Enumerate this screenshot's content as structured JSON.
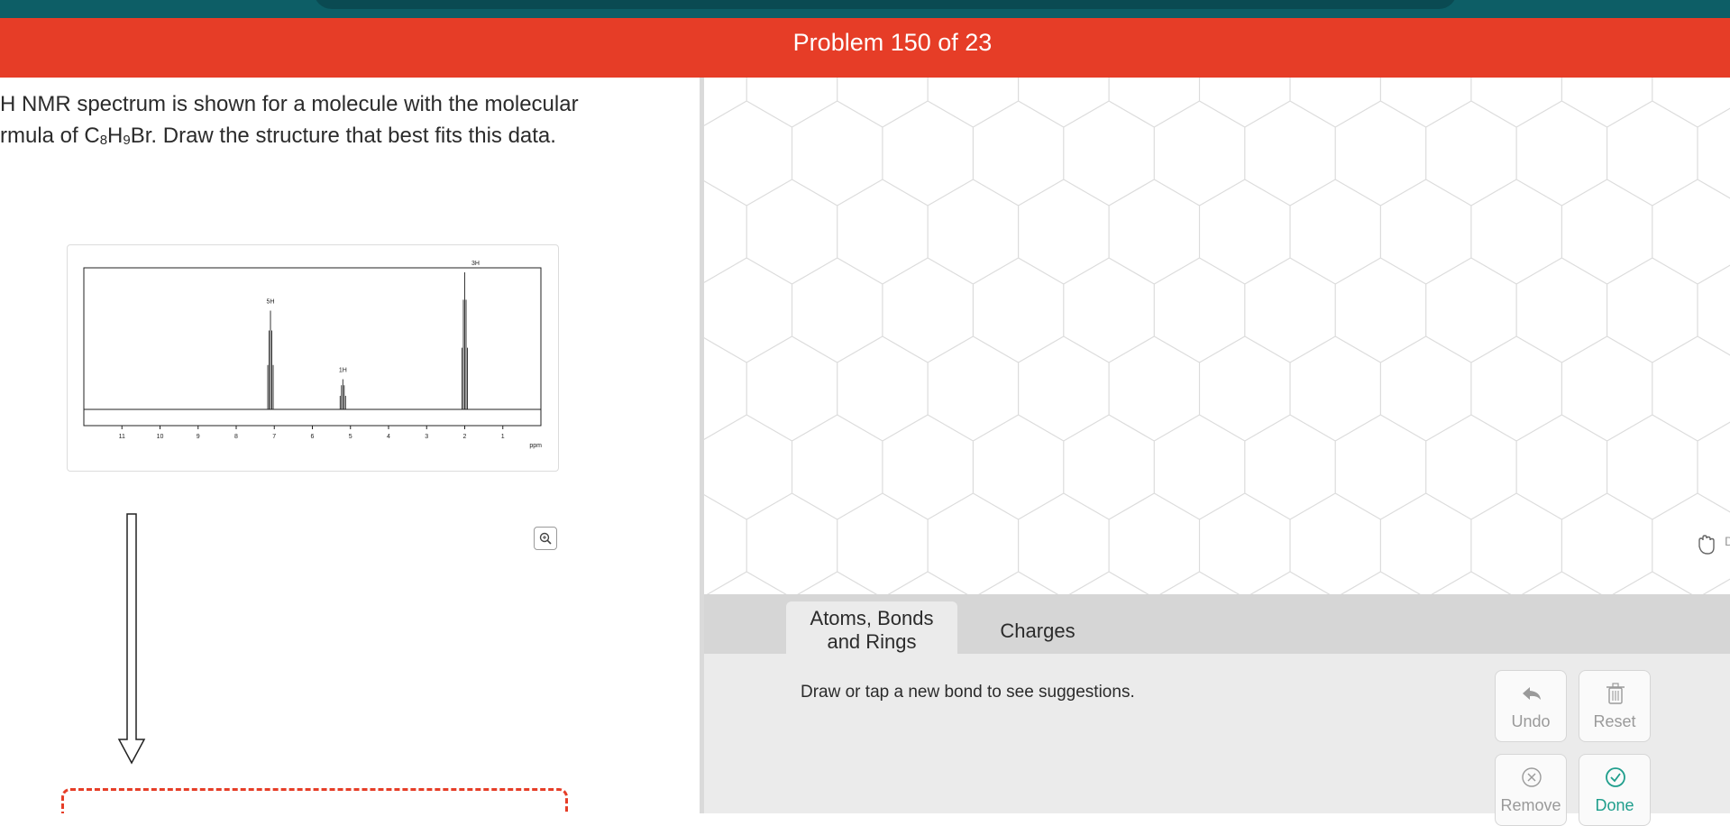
{
  "header": {
    "title": "Problem 150 of 23"
  },
  "question": {
    "line1": "H NMR spectrum is shown for a molecule with the molecular",
    "line2_prefix": "rmula of C",
    "sub1": "8",
    "mid": "H",
    "sub2": "9",
    "line2_suffix": "Br. Draw the structure that best fits this data."
  },
  "spectrum": {
    "x_ticks": [
      "11",
      "10",
      "9",
      "8",
      "7",
      "6",
      "5",
      "4",
      "3",
      "2",
      "1"
    ],
    "x_unit": "ppm",
    "peak_labels": [
      "5H",
      "1H",
      "3H"
    ]
  },
  "chart_data": {
    "type": "line",
    "title": "",
    "xlabel": "ppm",
    "ylabel": "",
    "xlim": [
      12,
      0
    ],
    "peaks": [
      {
        "shift": 7.1,
        "integration": "5H",
        "relative_height": 0.72
      },
      {
        "shift": 5.2,
        "integration": "1H",
        "relative_height": 0.22
      },
      {
        "shift": 2.0,
        "integration": "3H",
        "relative_height": 1.0
      }
    ]
  },
  "toolbar": {
    "tab_atoms": "Atoms, Bonds and Rings",
    "tab_atoms_line1": "Atoms, Bonds",
    "tab_atoms_line2": "and Rings",
    "tab_charges": "Charges"
  },
  "panel": {
    "hint": "Draw or tap a new bond to see suggestions.",
    "undo": "Undo",
    "reset": "Reset",
    "remove": "Remove",
    "done": "Done"
  },
  "canvas": {
    "hand_label": "D"
  },
  "colors": {
    "header_red": "#e63d27",
    "top_teal": "#0d5e66",
    "done_green": "#1f9e8c"
  }
}
